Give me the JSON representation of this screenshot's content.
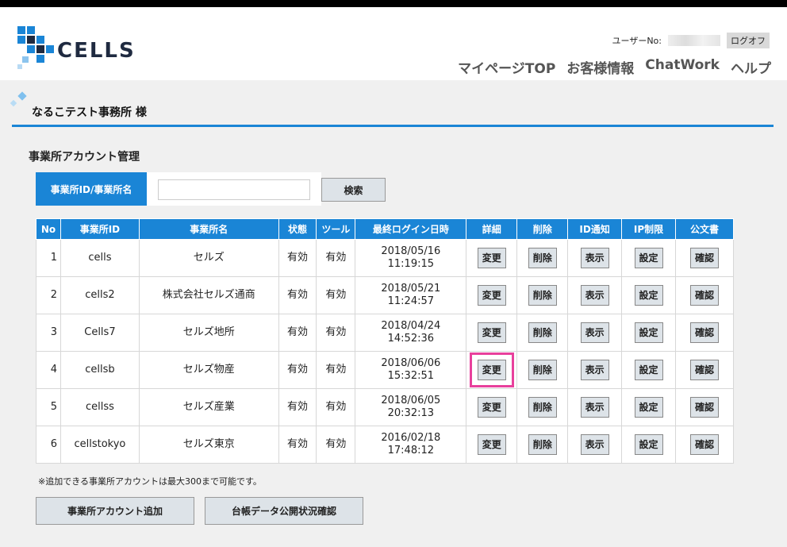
{
  "brand": {
    "name": "CELLS",
    "primary": "#1a85d6",
    "dark": "#1f2a40"
  },
  "header": {
    "user_label": "ユーザーNo:",
    "logout_label": "ログオフ",
    "nav": [
      "マイページTOP",
      "お客様情報",
      "ChatWork",
      "ヘルプ"
    ]
  },
  "office": {
    "title": "なるこテスト事務所 様"
  },
  "section": {
    "title": "事業所アカウント管理"
  },
  "search": {
    "label": "事業所ID/事業所名",
    "value": "",
    "placeholder": "",
    "button": "検索"
  },
  "table": {
    "columns": [
      "No",
      "事業所ID",
      "事業所名",
      "状態",
      "ツール",
      "最終ログイン日時",
      "詳細",
      "削除",
      "ID通知",
      "IP制限",
      "公文書"
    ],
    "actions": {
      "detail": "変更",
      "delete": "削除",
      "notify": "表示",
      "ip": "設定",
      "doc": "確認"
    },
    "rows": [
      {
        "no": "1",
        "id": "cells",
        "name": "セルズ",
        "status": "有効",
        "tool": "有効",
        "date": "2018/05/16",
        "time": "11:19:15"
      },
      {
        "no": "2",
        "id": "cells2",
        "name": "株式会社セルズ通商",
        "status": "有効",
        "tool": "有効",
        "date": "2018/05/21",
        "time": "11:24:57"
      },
      {
        "no": "3",
        "id": "Cells7",
        "name": "セルズ地所",
        "status": "有効",
        "tool": "有効",
        "date": "2018/04/24",
        "time": "14:52:36"
      },
      {
        "no": "4",
        "id": "cellsb",
        "name": "セルズ物産",
        "status": "有効",
        "tool": "有効",
        "date": "2018/06/06",
        "time": "15:32:51"
      },
      {
        "no": "5",
        "id": "cellss",
        "name": "セルズ産業",
        "status": "有効",
        "tool": "有効",
        "date": "2018/06/05",
        "time": "20:32:13"
      },
      {
        "no": "6",
        "id": "cellstokyo",
        "name": "セルズ東京",
        "status": "有効",
        "tool": "有効",
        "date": "2016/02/18",
        "time": "17:48:12"
      }
    ]
  },
  "note": "※追加できる事業所アカウントは最大300まで可能です。",
  "buttons": {
    "add": "事業所アカウント追加",
    "ledger": "台帳データ公開状況確認"
  },
  "highlight": {
    "row": "4",
    "color": "#e8409c"
  }
}
